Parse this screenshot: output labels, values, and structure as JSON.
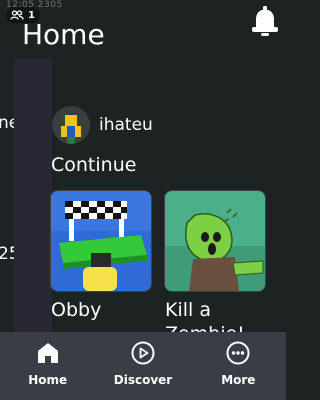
{
  "status": {
    "text": "12:05 2305"
  },
  "friends": {
    "count": "1",
    "icon": "people-icon"
  },
  "header": {
    "title": "Home",
    "bell_icon": "bell-icon"
  },
  "edge": {
    "line1": "ne",
    "line2": "25"
  },
  "user": {
    "name": "ihateu",
    "avatar_icon": "avatar-icon"
  },
  "continue": {
    "title": "Continue",
    "games": [
      {
        "title": "Obby"
      },
      {
        "title_line1": "Kill a",
        "title_line2": "Zombie!..."
      }
    ]
  },
  "nav": {
    "items": [
      {
        "label": "Home",
        "icon": "home-icon"
      },
      {
        "label": "Discover",
        "icon": "play-circle-icon"
      },
      {
        "label": "More",
        "icon": "more-icon"
      }
    ]
  },
  "colors": {
    "background": "#1d2222",
    "nav_background": "#393e46",
    "side_panel": "#2a2735"
  }
}
